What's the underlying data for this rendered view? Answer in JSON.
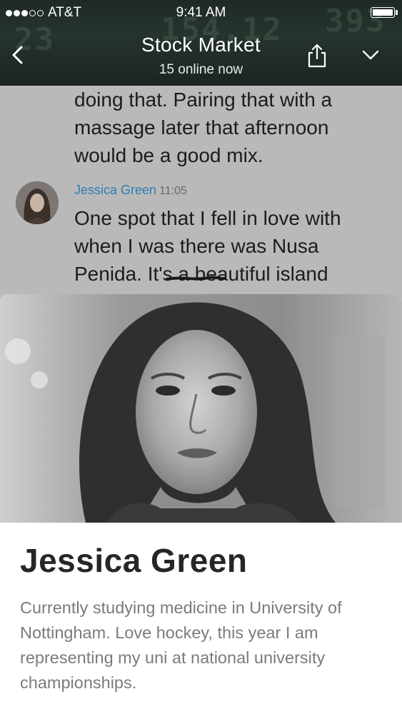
{
  "status_bar": {
    "carrier": "AT&T",
    "time": "9:41 AM",
    "signal_bars_filled": 3,
    "signal_bars_total": 5
  },
  "header": {
    "title": "Stock Market",
    "subtitle": "15 online now",
    "background_ticker_numbers": [
      "23",
      "154.12",
      "393"
    ],
    "icons": {
      "back": "chevron-left-icon",
      "share": "share-icon",
      "expand": "chevron-down-icon"
    }
  },
  "chat": {
    "previous_message": "doing that. Pairing that with a\nmassage later that afternoon\nwould be a good mix.",
    "message": {
      "sender": "Jessica Green",
      "time": "11:05",
      "text": "One spot that I fell in love with\nwhen I was there was Nusa\nPenida. It's a beautiful island\nthat is covered for a couple of",
      "sender_color": "#2f7db0"
    }
  },
  "profile": {
    "name": "Jessica Green",
    "bio": "Currently studying medicine in University of Nottingham. Love hockey, this year I am representing my uni at national university championships."
  }
}
